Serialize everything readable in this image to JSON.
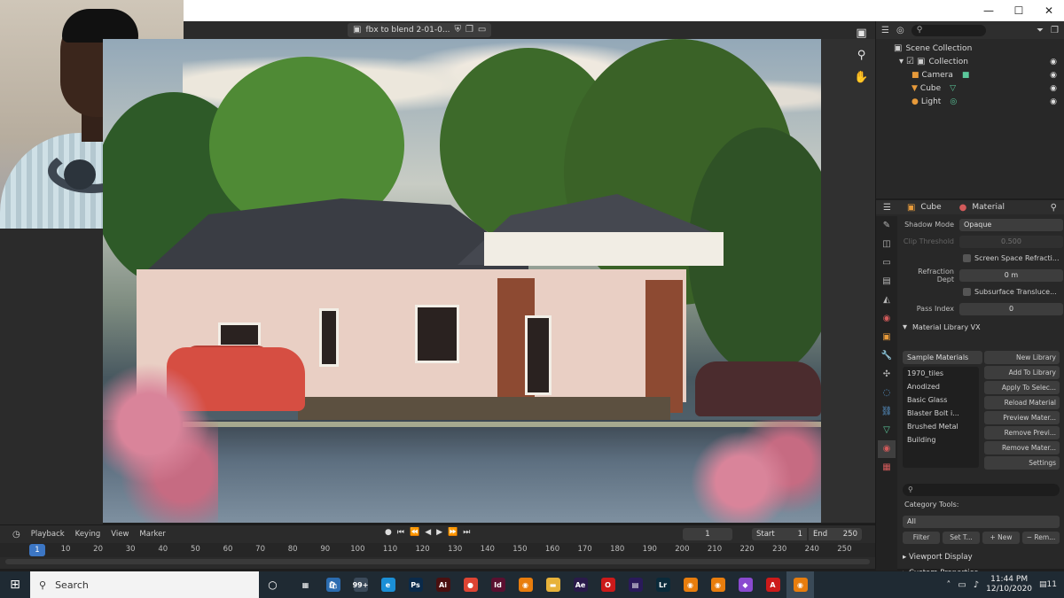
{
  "window": {
    "file_tab": "fbx to blend 2-01-0...",
    "controls": {
      "minimize": "—",
      "maximize": "☐",
      "close": "✕"
    }
  },
  "outliner": {
    "search_placeholder": "",
    "scene_collection": "Scene Collection",
    "collection": "Collection",
    "objects": [
      {
        "name": "Camera",
        "icon": "camera-icon"
      },
      {
        "name": "Cube",
        "icon": "cube-icon"
      },
      {
        "name": "Light",
        "icon": "light-icon"
      }
    ]
  },
  "properties": {
    "object_name": "Cube",
    "material_name": "Material",
    "rows": [
      {
        "label": "Shadow Mode",
        "value": "Opaque"
      },
      {
        "label": "Clip Threshold",
        "value": "0.500"
      }
    ],
    "screen_space_refraction": "Screen Space Refracti...",
    "refraction_depth_label": "Refraction Dept",
    "refraction_depth_value": "0 m",
    "subsurface_translucency": "Subsurface Transluce...",
    "pass_index_label": "Pass Index",
    "pass_index_value": "0",
    "material_library_header": "Material Library VX",
    "sample_materials": "Sample Materials",
    "materials": [
      "1970_tiles",
      "Anodized",
      "Basic Glass",
      "Blaster Bolt i...",
      "Brushed Metal",
      "Building"
    ],
    "buttons": [
      "New Library",
      "Add To Library",
      "Apply To Selec...",
      "Reload Material",
      "Preview Mater...",
      "Remove Previ...",
      "Remove Mater...",
      "Settings"
    ],
    "category_tools": "Category Tools:",
    "category_value": "All",
    "category_buttons": [
      "Filter",
      "Set T...",
      "+ New",
      "− Rem..."
    ],
    "viewport_display": "Viewport Display",
    "custom_properties": "Custom Properties"
  },
  "timeline": {
    "menus": [
      "Playback",
      "Keying",
      "View",
      "Marker"
    ],
    "current_frame": "1",
    "start_label": "Start",
    "start_value": "1",
    "end_label": "End",
    "end_value": "250",
    "playhead": "1",
    "ticks": [
      "10",
      "20",
      "30",
      "40",
      "50",
      "60",
      "70",
      "80",
      "90",
      "100",
      "110",
      "120",
      "130",
      "140",
      "150",
      "160",
      "170",
      "180",
      "190",
      "200",
      "210",
      "220",
      "230",
      "240",
      "250"
    ]
  },
  "taskbar": {
    "search_placeholder": "Search",
    "apps": [
      {
        "name": "task-view",
        "glyph": "▦",
        "color": "#1f2a33"
      },
      {
        "name": "store",
        "glyph": "🛍",
        "color": "#2b6cb0"
      },
      {
        "name": "chrome-dev",
        "glyph": "99+",
        "color": "#3b4a5a"
      },
      {
        "name": "edge",
        "glyph": "e",
        "color": "#1b8fd6"
      },
      {
        "name": "photoshop",
        "glyph": "Ps",
        "color": "#0a2a4a"
      },
      {
        "name": "acrobat-reader",
        "glyph": "Ai",
        "color": "#4a1010"
      },
      {
        "name": "chrome",
        "glyph": "●",
        "color": "#dd4433"
      },
      {
        "name": "indesign",
        "glyph": "Id",
        "color": "#5a1030"
      },
      {
        "name": "blender-a",
        "glyph": "◉",
        "color": "#e87d0d"
      },
      {
        "name": "file-explorer",
        "glyph": "▬",
        "color": "#e7b23a"
      },
      {
        "name": "after-effects",
        "glyph": "Ae",
        "color": "#2a1a4a"
      },
      {
        "name": "opera",
        "glyph": "O",
        "color": "#cc1a1a"
      },
      {
        "name": "premiere",
        "glyph": "▤",
        "color": "#2a1a5a"
      },
      {
        "name": "lightroom",
        "glyph": "Lr",
        "color": "#0a2a3a"
      },
      {
        "name": "blender-b",
        "glyph": "◉",
        "color": "#e87d0d"
      },
      {
        "name": "blender-c",
        "glyph": "◉",
        "color": "#e87d0d"
      },
      {
        "name": "inkscape",
        "glyph": "◆",
        "color": "#8a4ad0"
      },
      {
        "name": "acrobat",
        "glyph": "A",
        "color": "#cc1a1a"
      },
      {
        "name": "blender-active",
        "glyph": "◉",
        "color": "#e87d0d"
      }
    ],
    "time": "11:44 PM",
    "date": "12/10/2020",
    "notifications": "11"
  }
}
